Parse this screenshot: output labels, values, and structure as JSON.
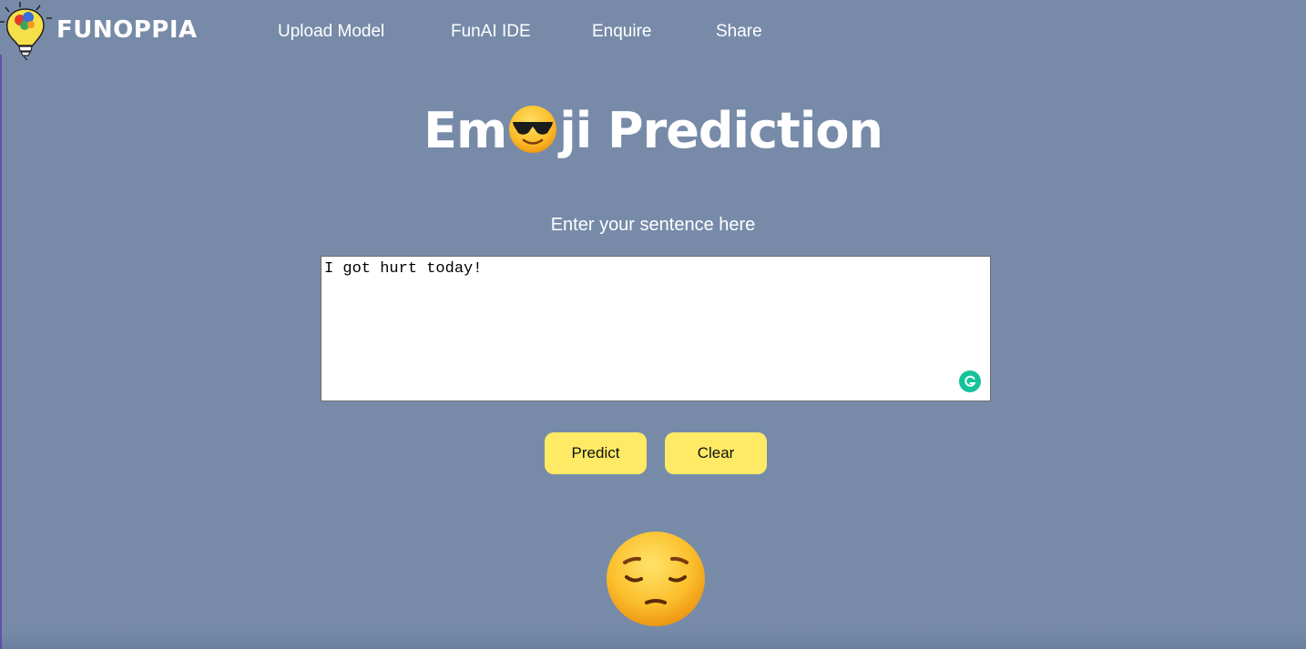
{
  "brand": {
    "name": "FUNOPPIA",
    "icon": "lightbulb-brain-icon"
  },
  "nav": {
    "links": [
      "Upload Model",
      "FunAI IDE",
      "Enquire",
      "Share"
    ]
  },
  "hero": {
    "title_before": "Em",
    "title_emoji": "sunglasses-face-emoji",
    "title_after": "ji Prediction",
    "subtitle": "Enter your sentence here"
  },
  "input": {
    "value": "I got hurt today!",
    "grammarly_icon": "grammarly-icon"
  },
  "buttons": {
    "predict_label": "Predict",
    "clear_label": "Clear"
  },
  "result": {
    "emoji": "pensive-face-emoji"
  },
  "colors": {
    "background": "#778ba9",
    "button": "#ffea66",
    "grammarly": "#15c39a",
    "text": "#ffffff"
  }
}
